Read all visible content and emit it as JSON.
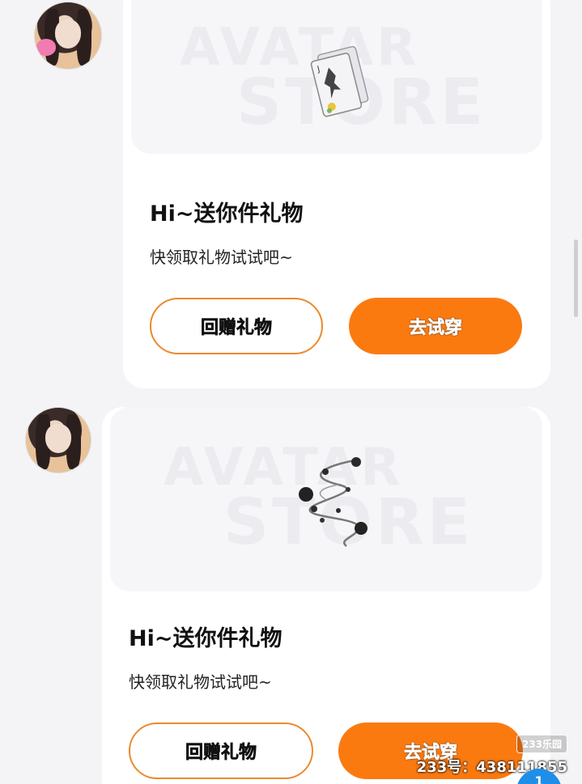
{
  "messages": [
    {
      "sender_avatar_icon": "user-avatar",
      "gift_item_icon": "poker-card-accessory",
      "banner_watermark_line1": "AVATAR",
      "banner_watermark_line2": "STORE",
      "title": "Hi~送你件礼物",
      "subtitle": "快领取礼物试试吧~",
      "return_gift_label": "回赠礼物",
      "try_on_label": "去试穿"
    },
    {
      "sender_avatar_icon": "user-avatar",
      "gift_item_icon": "spiral-flower-vine-accessory",
      "banner_watermark_line1": "AVATAR",
      "banner_watermark_line2": "STORE",
      "title": "Hi~送你件礼物",
      "subtitle": "快领取礼物试试吧~",
      "return_gift_label": "回赠礼物",
      "try_on_label": "去试穿"
    }
  ],
  "overlay": {
    "site_logo": "233乐园",
    "user_id": "233号：438111855",
    "unread_count": "1"
  },
  "colors": {
    "accent_orange": "#fb7a10",
    "outline_orange": "#ea8a2e",
    "background": "#f4f4f7",
    "badge_blue": "#1e8fe8"
  }
}
